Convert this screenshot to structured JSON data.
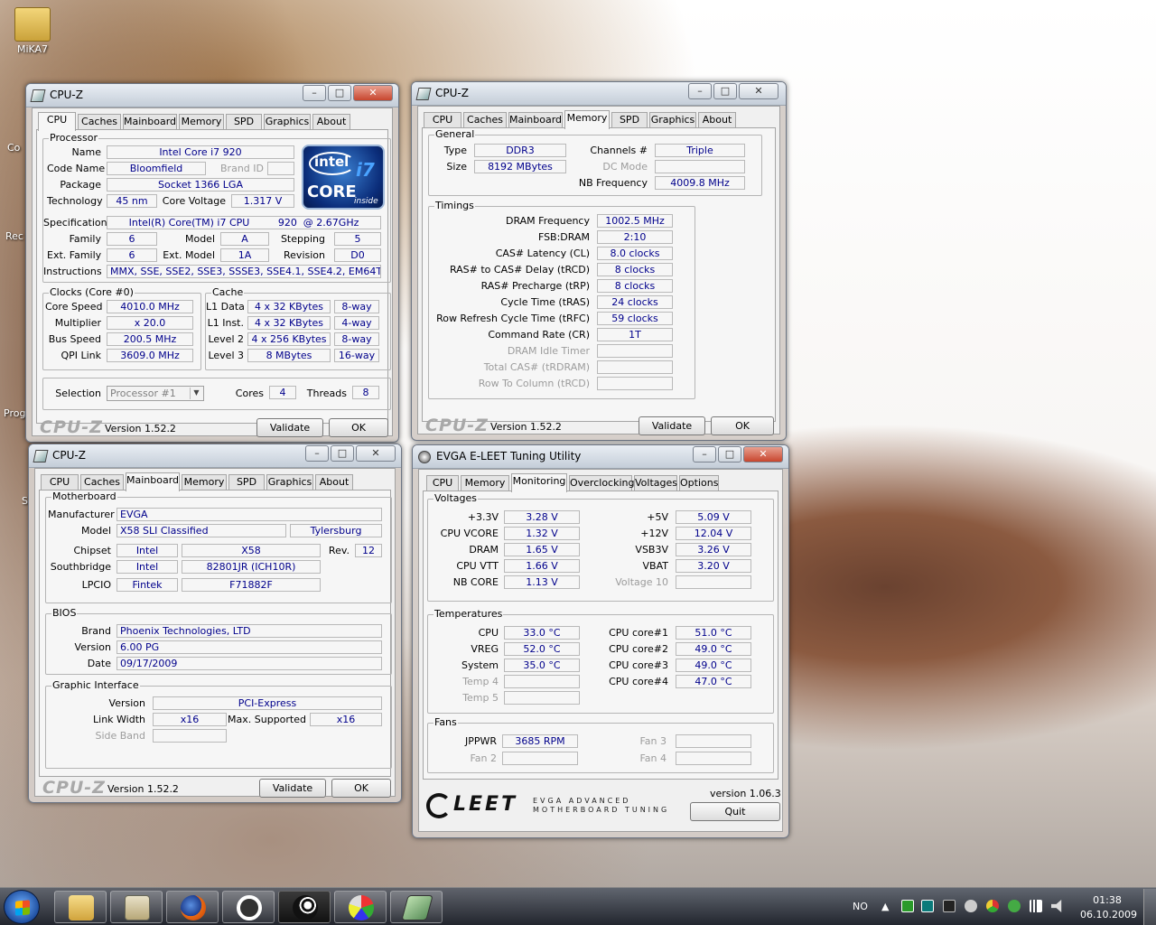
{
  "desktop": {
    "icon_label": "MiKA7",
    "side_labels": [
      "Co",
      "Rec",
      "Prog",
      "S"
    ]
  },
  "cpuz_cpu": {
    "title": "CPU-Z",
    "tabs": [
      "CPU",
      "Caches",
      "Mainboard",
      "Memory",
      "SPD",
      "Graphics",
      "About"
    ],
    "active_tab": "CPU",
    "processor_label": "Processor",
    "name_label": "Name",
    "name": "Intel Core i7 920",
    "codename_label": "Code Name",
    "codename": "Bloomfield",
    "brandid_label": "Brand ID",
    "brandid": "",
    "package_label": "Package",
    "package": "Socket 1366 LGA",
    "technology_label": "Technology",
    "technology": "45 nm",
    "corevoltage_label": "Core Voltage",
    "corevoltage": "1.317 V",
    "spec_label": "Specification",
    "spec": "Intel(R) Core(TM) i7 CPU         920  @ 2.67GHz",
    "family_label": "Family",
    "family": "6",
    "model_label": "Model",
    "model": "A",
    "stepping_label": "Stepping",
    "stepping": "5",
    "extfamily_label": "Ext. Family",
    "extfamily": "6",
    "extmodel_label": "Ext. Model",
    "extmodel": "1A",
    "revision_label": "Revision",
    "revision": "D0",
    "instructions_label": "Instructions",
    "instructions": "MMX, SSE, SSE2, SSE3, SSSE3, SSE4.1, SSE4.2, EM64T",
    "clocks_label": "Clocks (Core #0)",
    "corespeed_label": "Core Speed",
    "corespeed": "4010.0 MHz",
    "multiplier_label": "Multiplier",
    "multiplier": "x 20.0",
    "busspeed_label": "Bus Speed",
    "busspeed": "200.5 MHz",
    "qpi_label": "QPI Link",
    "qpi": "3609.0 MHz",
    "cache_label": "Cache",
    "l1d_label": "L1 Data",
    "l1d": "4 x 32 KBytes",
    "l1d_way": "8-way",
    "l1i_label": "L1 Inst.",
    "l1i": "4 x 32 KBytes",
    "l1i_way": "4-way",
    "l2_label": "Level 2",
    "l2": "4 x 256 KBytes",
    "l2_way": "8-way",
    "l3_label": "Level 3",
    "l3": "8 MBytes",
    "l3_way": "16-way",
    "selection_label": "Selection",
    "selection": "Processor #1",
    "cores_label": "Cores",
    "cores": "4",
    "threads_label": "Threads",
    "threads": "8",
    "brand": "CPU-Z",
    "version": "Version 1.52.2",
    "validate": "Validate",
    "ok": "OK",
    "logo": {
      "intel": "intel",
      "i7": "i7",
      "core": "CORE",
      "inside": "inside"
    }
  },
  "cpuz_mem": {
    "title": "CPU-Z",
    "tabs": [
      "CPU",
      "Caches",
      "Mainboard",
      "Memory",
      "SPD",
      "Graphics",
      "About"
    ],
    "active_tab": "Memory",
    "general_label": "General",
    "type_label": "Type",
    "type": "DDR3",
    "size_label": "Size",
    "size": "8192 MBytes",
    "channels_label": "Channels #",
    "channels": "Triple",
    "dcmode_label": "DC Mode",
    "dcmode": "",
    "nbfreq_label": "NB Frequency",
    "nbfreq": "4009.8 MHz",
    "timings_label": "Timings",
    "timings": [
      {
        "label": "DRAM Frequency",
        "value": "1002.5 MHz",
        "dim": false
      },
      {
        "label": "FSB:DRAM",
        "value": "2:10",
        "dim": false
      },
      {
        "label": "CAS# Latency (CL)",
        "value": "8.0 clocks",
        "dim": false
      },
      {
        "label": "RAS# to CAS# Delay (tRCD)",
        "value": "8 clocks",
        "dim": false
      },
      {
        "label": "RAS# Precharge (tRP)",
        "value": "8 clocks",
        "dim": false
      },
      {
        "label": "Cycle Time (tRAS)",
        "value": "24 clocks",
        "dim": false
      },
      {
        "label": "Row Refresh Cycle Time (tRFC)",
        "value": "59 clocks",
        "dim": false
      },
      {
        "label": "Command Rate (CR)",
        "value": "1T",
        "dim": false
      },
      {
        "label": "DRAM Idle Timer",
        "value": "",
        "dim": true
      },
      {
        "label": "Total CAS# (tRDRAM)",
        "value": "",
        "dim": true
      },
      {
        "label": "Row To Column (tRCD)",
        "value": "",
        "dim": true
      }
    ],
    "brand": "CPU-Z",
    "version": "Version 1.52.2",
    "validate": "Validate",
    "ok": "OK"
  },
  "cpuz_mb": {
    "title": "CPU-Z",
    "tabs": [
      "CPU",
      "Caches",
      "Mainboard",
      "Memory",
      "SPD",
      "Graphics",
      "About"
    ],
    "active_tab": "Mainboard",
    "motherboard_label": "Motherboard",
    "manufacturer_label": "Manufacturer",
    "manufacturer": "EVGA",
    "model_label": "Model",
    "model": "X58 SLI Classified",
    "model2": "Tylersburg",
    "chipset_label": "Chipset",
    "chipset": "Intel",
    "chipset2": "X58",
    "rev_label": "Rev.",
    "rev": "12",
    "southbridge_label": "Southbridge",
    "southbridge": "Intel",
    "southbridge2": "82801JR (ICH10R)",
    "lpcio_label": "LPCIO",
    "lpcio": "Fintek",
    "lpcio2": "F71882F",
    "bios_label": "BIOS",
    "brand_label": "Brand",
    "bios_brand": "Phoenix Technologies, LTD",
    "version_label": "Version",
    "bios_version": "6.00 PG",
    "date_label": "Date",
    "bios_date": "09/17/2009",
    "gi_label": "Graphic Interface",
    "giver_label": "Version",
    "giver": "PCI-Express",
    "linkwidth_label": "Link Width",
    "linkwidth": "x16",
    "maxsup_label": "Max. Supported",
    "maxsup": "x16",
    "sideband_label": "Side Band",
    "sideband": "",
    "brand": "CPU-Z",
    "version": "Version 1.52.2",
    "validate": "Validate",
    "ok": "OK"
  },
  "eleet": {
    "title": "EVGA E-LEET Tuning Utility",
    "tabs": [
      "CPU",
      "Memory",
      "Monitoring",
      "Overclocking",
      "Voltages",
      "Options"
    ],
    "active_tab": "Monitoring",
    "voltages_label": "Voltages",
    "v33_label": "+3.3V",
    "v33": "3.28 V",
    "vcore_label": "CPU VCORE",
    "vcore": "1.32 V",
    "dram_label": "DRAM",
    "dram": "1.65 V",
    "vtt_label": "CPU VTT",
    "vtt": "1.66 V",
    "nbcore_label": "NB CORE",
    "nbcore": "1.13 V",
    "v5_label": "+5V",
    "v5": "5.09 V",
    "v12_label": "+12V",
    "v12": "12.04 V",
    "vsb_label": "VSB3V",
    "vsb": "3.26 V",
    "vbat_label": "VBAT",
    "vbat": "3.20 V",
    "v10_label": "Voltage 10",
    "v10": "",
    "temps_label": "Temperatures",
    "tcpu_label": "CPU",
    "tcpu": "33.0 °C",
    "tvreg_label": "VREG",
    "tvreg": "52.0 °C",
    "tsys_label": "System",
    "tsys": "35.0 °C",
    "t4_label": "Temp 4",
    "t4": "",
    "t5_label": "Temp 5",
    "t5": "",
    "tc1_label": "CPU core#1",
    "tc1": "51.0 °C",
    "tc2_label": "CPU core#2",
    "tc2": "49.0 °C",
    "tc3_label": "CPU core#3",
    "tc3": "49.0 °C",
    "tc4_label": "CPU core#4",
    "tc4": "47.0 °C",
    "fans_label": "Fans",
    "f1_label": "JPPWR",
    "f1": "3685 RPM",
    "f2_label": "Fan 2",
    "f2": "",
    "f3_label": "Fan 3",
    "f3": "",
    "f4_label": "Fan 4",
    "f4": "",
    "logo": "LEET",
    "tagline1": "EVGA ADVANCED",
    "tagline2": "MOTHERBOARD TUNING",
    "version": "version 1.06.3",
    "quit": "Quit"
  },
  "taskbar": {
    "lang": "NO",
    "time": "01:38",
    "date": "06.10.2009"
  }
}
